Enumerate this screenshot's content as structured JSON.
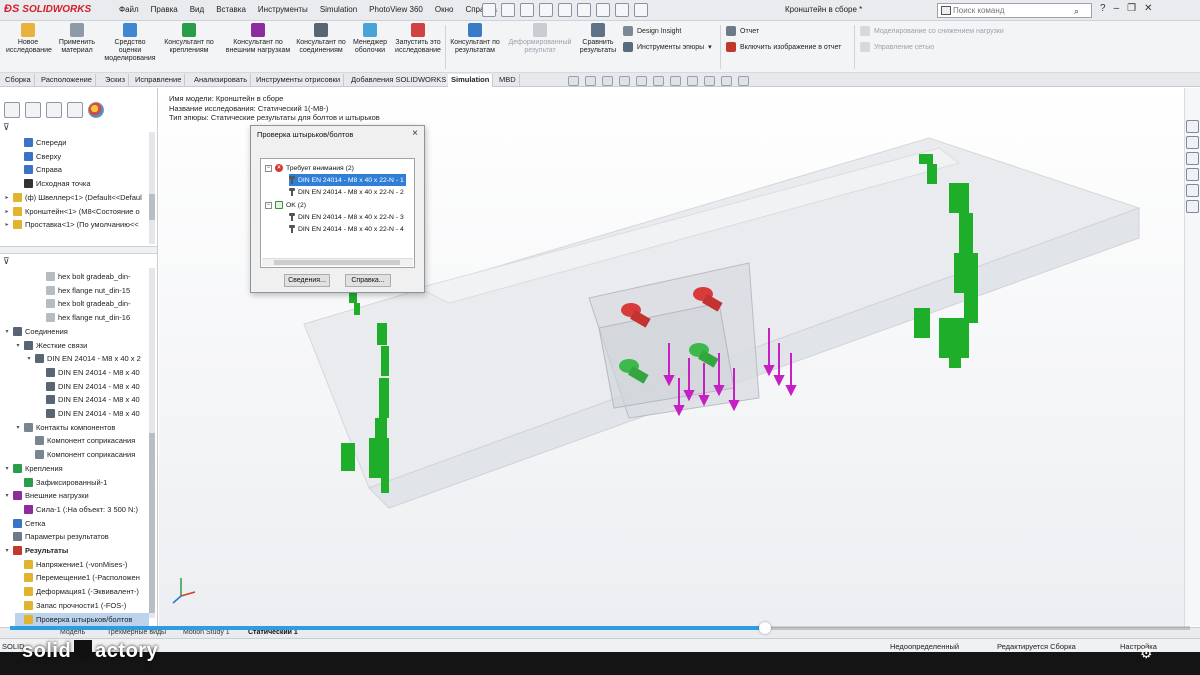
{
  "app": {
    "logo": "SOLIDWORKS",
    "menu": [
      "Файл",
      "Правка",
      "Вид",
      "Вставка",
      "Инструменты",
      "Simulation",
      "PhotoView 360",
      "Окно",
      "Справка"
    ],
    "doc_title": "Кронштейн в сборе *",
    "search_placeholder": "Поиск команд",
    "help_icon": "?"
  },
  "commands": {
    "new_study": "Новое исследование",
    "apply_material": "Применить материал",
    "assess": "Средство оценки моделирования",
    "fixtures_advisor": "Консультант по креплениям",
    "loads_advisor": "Консультант по внешним нагрузкам",
    "connections_advisor": "Консультант по соединениям",
    "shell_manager": "Менеджер оболочки",
    "run_study": "Запустить это исследование",
    "results_advisor": "Консультант по результатам",
    "deformed_result": "Деформированный результат",
    "compare_results": "Сравнить результаты",
    "design_insight": "Design Insight",
    "plot_tools": "Инструменты эпюры",
    "report": "Отчет",
    "include_image": "Включить изображение в отчет",
    "reduced_load": "Моделирование со снижением нагрузки",
    "network_management": "Управление сетью"
  },
  "tabs": [
    "Сборка",
    "Расположение",
    "Эскиз",
    "Исправление",
    "Анализировать",
    "Инструменты отрисовки",
    "Добавления SOLIDWORKS",
    "Simulation",
    "MBD"
  ],
  "active_tab": "Simulation",
  "tree_top": [
    {
      "label": "Спереди",
      "indent": 1,
      "icon": "plane"
    },
    {
      "label": "Сверху",
      "indent": 1,
      "icon": "plane"
    },
    {
      "label": "Справа",
      "indent": 1,
      "icon": "plane"
    },
    {
      "label": "Исходная точка",
      "indent": 1,
      "icon": "origin"
    },
    {
      "label": "(ф) Швеллер<1> (Default<<Defaul",
      "indent": 0,
      "icon": "part",
      "exp": "▸"
    },
    {
      "label": "Кронштейн<1> (M8<Состояние о",
      "indent": 0,
      "icon": "part",
      "exp": "▸"
    },
    {
      "label": "Проставка<1> (По умолчанию<<",
      "indent": 0,
      "icon": "part",
      "exp": "▸"
    }
  ],
  "tree_sim": [
    {
      "label": "hex bolt gradeab_din-",
      "indent": 3,
      "icon": "cube"
    },
    {
      "label": "hex flange nut_din-15",
      "indent": 3,
      "icon": "cube"
    },
    {
      "label": "hex bolt gradeab_din-",
      "indent": 3,
      "icon": "cube"
    },
    {
      "label": "hex flange nut_din-16",
      "indent": 3,
      "icon": "cube"
    },
    {
      "label": "Соединения",
      "indent": 0,
      "icon": "conn",
      "exp": "▾"
    },
    {
      "label": "Жесткие связи",
      "indent": 1,
      "icon": "conn",
      "exp": "▾"
    },
    {
      "label": "DIN EN 24014 - M8 x 40 x 2",
      "indent": 2,
      "icon": "bolt",
      "exp": "▾"
    },
    {
      "label": "DIN EN 24014 - M8 x 40",
      "indent": 3,
      "icon": "bolt"
    },
    {
      "label": "DIN EN 24014 - M8 x 40",
      "indent": 3,
      "icon": "bolt"
    },
    {
      "label": "DIN EN 24014 - M8 x 40",
      "indent": 3,
      "icon": "bolt"
    },
    {
      "label": "DIN EN 24014 - M8 x 40",
      "indent": 3,
      "icon": "bolt"
    },
    {
      "label": "Контакты компонентов",
      "indent": 1,
      "icon": "contact",
      "exp": "▾"
    },
    {
      "label": "Компонент соприкасания",
      "indent": 2,
      "icon": "contact"
    },
    {
      "label": "Компонент соприкасания",
      "indent": 2,
      "icon": "contact"
    },
    {
      "label": "Крепления",
      "indent": 0,
      "icon": "fix",
      "exp": "▾"
    },
    {
      "label": "Зафиксированный-1",
      "indent": 1,
      "icon": "fix"
    },
    {
      "label": "Внешние нагрузки",
      "indent": 0,
      "icon": "load",
      "exp": "▾"
    },
    {
      "label": "Сила-1 (:На объект: 3 500 N:)",
      "indent": 1,
      "icon": "load"
    },
    {
      "label": "Сетка",
      "indent": 0,
      "icon": "mesh"
    },
    {
      "label": "Параметры результатов",
      "indent": 0,
      "icon": "params"
    },
    {
      "label": "Результаты",
      "indent": 0,
      "icon": "results",
      "exp": "▾",
      "bold": true
    },
    {
      "label": "Напряжение1 (-vonMises-)",
      "indent": 1,
      "icon": "plot"
    },
    {
      "label": "Перемещение1 (-Расположен",
      "indent": 1,
      "icon": "plot"
    },
    {
      "label": "Деформация1 (-Эквивалент-)",
      "indent": 1,
      "icon": "plot"
    },
    {
      "label": "Запас прочности1 (-FOS-)",
      "indent": 1,
      "icon": "plot"
    },
    {
      "label": "Проверка штырьков/болтов",
      "indent": 1,
      "icon": "plot",
      "selected": true
    }
  ],
  "info": {
    "model": "Имя модели: Кронштейн в сборе",
    "study": "Название исследования: Статический 1(-M8-)",
    "plot_type": "Тип эпюры: Статические результаты для болтов и штырьков"
  },
  "dialog": {
    "title": "Проверка штырьков/болтов",
    "close": "×",
    "group_warning": "Требует внимания (2)",
    "group_ok": "OK (2)",
    "items_warning": [
      "DIN EN 24014 - M8 x 40 x 22-N - 1",
      "DIN EN 24014 - M8 x 40 x 22-N - 2"
    ],
    "items_ok": [
      "DIN EN 24014 - M8 x 40 x 22-N - 3",
      "DIN EN 24014 - M8 x 40 x 22-N - 4"
    ],
    "btn_details": "Сведения...",
    "btn_help": "Справка..."
  },
  "model_tabs": [
    "Модель",
    "Трехмерные виды",
    "Motion Study 1",
    "Статический 1"
  ],
  "active_model_tab": "Статический 1",
  "status": {
    "left": "SOLID",
    "definition": "Недоопределенный",
    "editing": "Редактируется Сборка",
    "settings": "Настройка"
  },
  "video": {
    "progress": 0.64
  },
  "watermark": {
    "left": "solid",
    "right": "actory"
  },
  "colors": {
    "accent": "#2f7ed8",
    "load": "#c51fc5",
    "fixture": "#1fae2a",
    "bolt_fail": "#d93b3b",
    "bolt_ok": "#3db84a"
  }
}
